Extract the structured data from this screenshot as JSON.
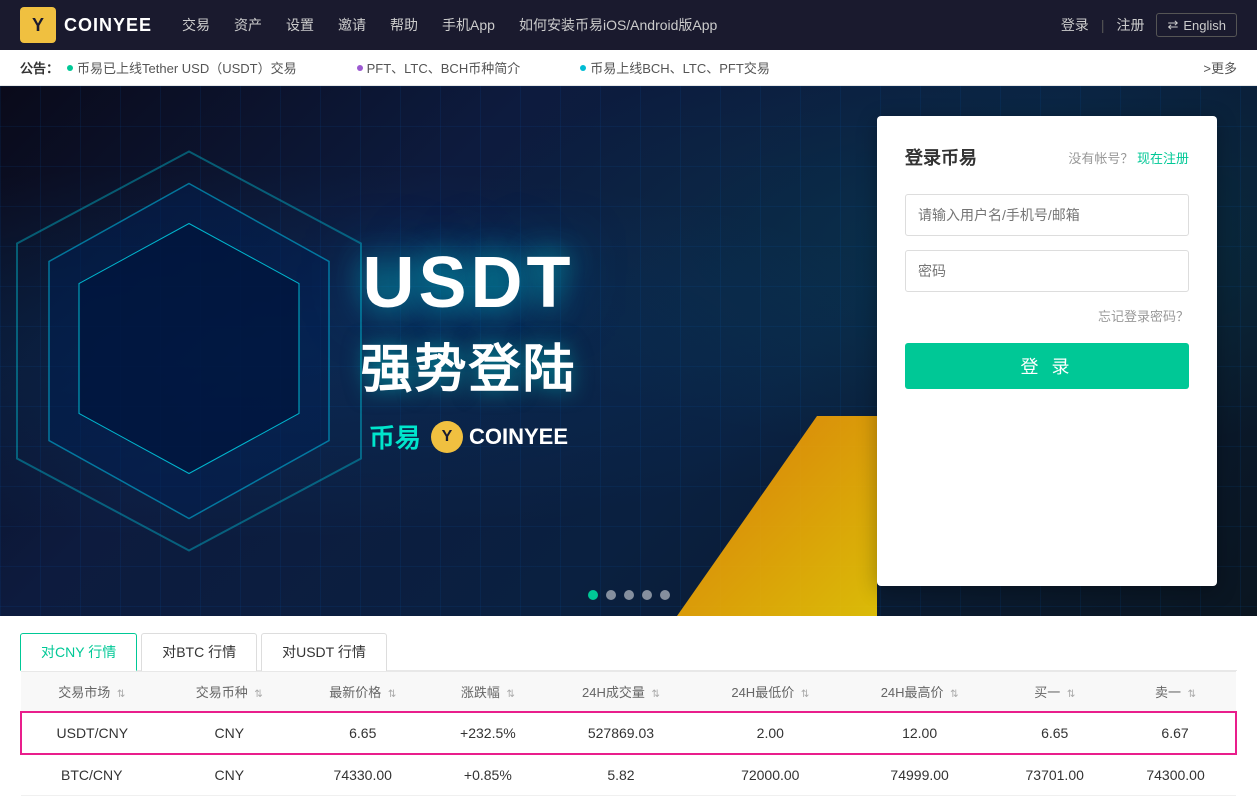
{
  "navbar": {
    "logo_letter": "Y",
    "logo_name": "COINYEE",
    "menu_items": [
      "交易",
      "资产",
      "设置",
      "邀请",
      "帮助",
      "手机App",
      "如何安装币易iOS/Android版App"
    ],
    "login": "登录",
    "divider": "|",
    "register": "注册",
    "language": "English",
    "lang_arrow": "⇄"
  },
  "announcement": {
    "label": "公告：",
    "items": [
      {
        "text": "币易已上线Tether USD（USDT）交易",
        "dot_color": "green"
      },
      {
        "text": "PFT、LTC、BCH币种简介",
        "dot_color": "purple"
      },
      {
        "text": "币易上线BCH、LTC、PFT交易",
        "dot_color": "teal"
      }
    ],
    "more": ">更多"
  },
  "hero": {
    "usdt": "USDT",
    "slogan": "强势登陆",
    "brand_chinese": "币易",
    "brand_english": "COINYEE",
    "brand_icon": "Y"
  },
  "login_panel": {
    "title": "登录币易",
    "no_account": "没有帐号？",
    "register_now": "现在注册",
    "username_placeholder": "请输入用户名/手机号/邮箱",
    "password_placeholder": "密码",
    "forgot_password": "忘记登录密码？",
    "login_btn": "登 录"
  },
  "carousel": {
    "dots": [
      true,
      false,
      false,
      false,
      false
    ],
    "active_index": 0
  },
  "market": {
    "tabs": [
      {
        "label": "对CNY 行情",
        "active": true
      },
      {
        "label": "对BTC 行情",
        "active": false
      },
      {
        "label": "对USDT 行情",
        "active": false
      }
    ],
    "columns": [
      {
        "label": "交易市场",
        "sortable": true
      },
      {
        "label": "交易币种",
        "sortable": true
      },
      {
        "label": "最新价格",
        "sortable": true
      },
      {
        "label": "涨跌幅",
        "sortable": true
      },
      {
        "label": "24H成交量",
        "sortable": true
      },
      {
        "label": "24H最低价",
        "sortable": true
      },
      {
        "label": "24H最高价",
        "sortable": true
      },
      {
        "label": "买一",
        "sortable": true
      },
      {
        "label": "卖一",
        "sortable": true
      }
    ],
    "rows": [
      {
        "market": "USDT/CNY",
        "currency": "CNY",
        "price": "6.65",
        "change": "+232.5%",
        "change_positive": true,
        "volume": "527869.03",
        "low": "2.00",
        "high": "12.00",
        "buy": "6.65",
        "sell": "6.67",
        "highlighted": true
      },
      {
        "market": "BTC/CNY",
        "currency": "CNY",
        "price": "74330.00",
        "change": "+0.85%",
        "change_positive": true,
        "volume": "5.82",
        "low": "72000.00",
        "high": "74999.00",
        "buy": "73701.00",
        "sell": "74300.00",
        "highlighted": false
      }
    ]
  }
}
